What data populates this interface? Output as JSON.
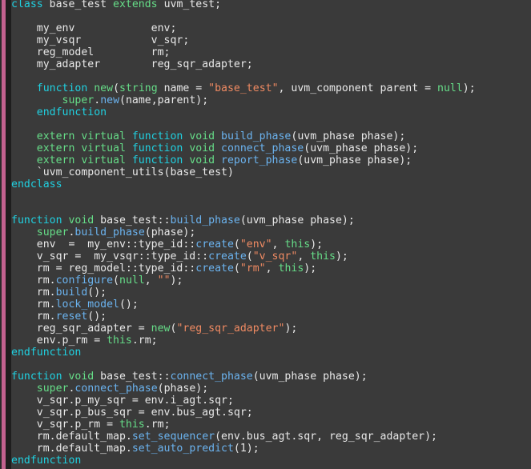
{
  "editor": {
    "language": "SystemVerilog",
    "colors": {
      "background": "#3a3a3a",
      "gutter": "#1e1e1e",
      "accent_stripe": "#c2628f",
      "default_text": "#e8e8e8",
      "keyword_cyan": "#20d0e0",
      "keyword_green": "#66dd88",
      "function_blue": "#6bb3ef",
      "string_orange": "#ef8a62"
    },
    "lines": [
      [
        {
          "t": "class ",
          "c": "kw"
        },
        {
          "t": "base_test ",
          "c": "plain"
        },
        {
          "t": "extends ",
          "c": "kw2"
        },
        {
          "t": "uvm_test;",
          "c": "plain"
        }
      ],
      [],
      [
        {
          "t": "    my_env            env;",
          "c": "plain"
        }
      ],
      [
        {
          "t": "    my_vsqr           v_sqr;",
          "c": "plain"
        }
      ],
      [
        {
          "t": "    reg_model         rm;",
          "c": "plain"
        }
      ],
      [
        {
          "t": "    my_adapter        reg_sqr_adapter;",
          "c": "plain"
        }
      ],
      [],
      [
        {
          "t": "    ",
          "c": "plain"
        },
        {
          "t": "function ",
          "c": "kw"
        },
        {
          "t": "new",
          "c": "kw2"
        },
        {
          "t": "(",
          "c": "plain"
        },
        {
          "t": "string ",
          "c": "kw2"
        },
        {
          "t": "name = ",
          "c": "plain"
        },
        {
          "t": "\"base_test\"",
          "c": "str"
        },
        {
          "t": ", uvm_component parent = ",
          "c": "plain"
        },
        {
          "t": "null",
          "c": "kw2"
        },
        {
          "t": ");",
          "c": "plain"
        }
      ],
      [
        {
          "t": "        ",
          "c": "plain"
        },
        {
          "t": "super",
          "c": "kw2"
        },
        {
          "t": ".",
          "c": "plain"
        },
        {
          "t": "new",
          "c": "fn"
        },
        {
          "t": "(name,parent);",
          "c": "plain"
        }
      ],
      [
        {
          "t": "    endfunction",
          "c": "kw"
        }
      ],
      [],
      [
        {
          "t": "    ",
          "c": "plain"
        },
        {
          "t": "extern virtual ",
          "c": "kw2"
        },
        {
          "t": "function ",
          "c": "kw"
        },
        {
          "t": "void ",
          "c": "kw2"
        },
        {
          "t": "build_phase",
          "c": "fn"
        },
        {
          "t": "(uvm_phase phase);",
          "c": "plain"
        }
      ],
      [
        {
          "t": "    ",
          "c": "plain"
        },
        {
          "t": "extern virtual ",
          "c": "kw2"
        },
        {
          "t": "function ",
          "c": "kw"
        },
        {
          "t": "void ",
          "c": "kw2"
        },
        {
          "t": "connect_phase",
          "c": "fn"
        },
        {
          "t": "(uvm_phase phase);",
          "c": "plain"
        }
      ],
      [
        {
          "t": "    ",
          "c": "plain"
        },
        {
          "t": "extern virtual ",
          "c": "kw2"
        },
        {
          "t": "function ",
          "c": "kw"
        },
        {
          "t": "void ",
          "c": "kw2"
        },
        {
          "t": "report_phase",
          "c": "fn"
        },
        {
          "t": "(uvm_phase phase);",
          "c": "plain"
        }
      ],
      [
        {
          "t": "    `uvm_component_utils(base_test)",
          "c": "plain"
        }
      ],
      [
        {
          "t": "endclass",
          "c": "kw"
        }
      ],
      [],
      [],
      [
        {
          "t": "function ",
          "c": "kw"
        },
        {
          "t": "void ",
          "c": "kw2"
        },
        {
          "t": "base_test::",
          "c": "plain"
        },
        {
          "t": "build_phase",
          "c": "fn"
        },
        {
          "t": "(uvm_phase phase);",
          "c": "plain"
        }
      ],
      [
        {
          "t": "    ",
          "c": "plain"
        },
        {
          "t": "super",
          "c": "kw2"
        },
        {
          "t": ".",
          "c": "plain"
        },
        {
          "t": "build_phase",
          "c": "fn"
        },
        {
          "t": "(phase);",
          "c": "plain"
        }
      ],
      [
        {
          "t": "    env  =  my_env::type_id::",
          "c": "plain"
        },
        {
          "t": "create",
          "c": "fn"
        },
        {
          "t": "(",
          "c": "plain"
        },
        {
          "t": "\"env\"",
          "c": "str"
        },
        {
          "t": ", ",
          "c": "plain"
        },
        {
          "t": "this",
          "c": "this"
        },
        {
          "t": ");",
          "c": "plain"
        }
      ],
      [
        {
          "t": "    v_sqr =  my_vsqr::type_id::",
          "c": "plain"
        },
        {
          "t": "create",
          "c": "fn"
        },
        {
          "t": "(",
          "c": "plain"
        },
        {
          "t": "\"v_sqr\"",
          "c": "str"
        },
        {
          "t": ", ",
          "c": "plain"
        },
        {
          "t": "this",
          "c": "this"
        },
        {
          "t": ");",
          "c": "plain"
        }
      ],
      [
        {
          "t": "    rm = reg_model::type_id::",
          "c": "plain"
        },
        {
          "t": "create",
          "c": "fn"
        },
        {
          "t": "(",
          "c": "plain"
        },
        {
          "t": "\"rm\"",
          "c": "str"
        },
        {
          "t": ", ",
          "c": "plain"
        },
        {
          "t": "this",
          "c": "this"
        },
        {
          "t": ");",
          "c": "plain"
        }
      ],
      [
        {
          "t": "    rm.",
          "c": "plain"
        },
        {
          "t": "configure",
          "c": "fn"
        },
        {
          "t": "(",
          "c": "plain"
        },
        {
          "t": "null",
          "c": "kw2"
        },
        {
          "t": ", ",
          "c": "plain"
        },
        {
          "t": "\"\"",
          "c": "str"
        },
        {
          "t": ");",
          "c": "plain"
        }
      ],
      [
        {
          "t": "    rm.",
          "c": "plain"
        },
        {
          "t": "build",
          "c": "fn"
        },
        {
          "t": "();",
          "c": "plain"
        }
      ],
      [
        {
          "t": "    rm.",
          "c": "plain"
        },
        {
          "t": "lock_model",
          "c": "fn"
        },
        {
          "t": "();",
          "c": "plain"
        }
      ],
      [
        {
          "t": "    rm.",
          "c": "plain"
        },
        {
          "t": "reset",
          "c": "fn"
        },
        {
          "t": "();",
          "c": "plain"
        }
      ],
      [
        {
          "t": "    reg_sqr_adapter = ",
          "c": "plain"
        },
        {
          "t": "new",
          "c": "kw2"
        },
        {
          "t": "(",
          "c": "plain"
        },
        {
          "t": "\"reg_sqr_adapter\"",
          "c": "str"
        },
        {
          "t": ");",
          "c": "plain"
        }
      ],
      [
        {
          "t": "    env.p_rm = ",
          "c": "plain"
        },
        {
          "t": "this",
          "c": "this"
        },
        {
          "t": ".rm;",
          "c": "plain"
        }
      ],
      [
        {
          "t": "endfunction",
          "c": "kw"
        }
      ],
      [],
      [
        {
          "t": "function ",
          "c": "kw"
        },
        {
          "t": "void ",
          "c": "kw2"
        },
        {
          "t": "base_test::",
          "c": "plain"
        },
        {
          "t": "connect_phase",
          "c": "fn"
        },
        {
          "t": "(uvm_phase phase);",
          "c": "plain"
        }
      ],
      [
        {
          "t": "    ",
          "c": "plain"
        },
        {
          "t": "super",
          "c": "kw2"
        },
        {
          "t": ".",
          "c": "plain"
        },
        {
          "t": "connect_phase",
          "c": "fn"
        },
        {
          "t": "(phase);",
          "c": "plain"
        }
      ],
      [
        {
          "t": "    v_sqr.p_my_sqr = env.i_agt.sqr;",
          "c": "plain"
        }
      ],
      [
        {
          "t": "    v_sqr.p_bus_sqr = env.bus_agt.sqr;",
          "c": "plain"
        }
      ],
      [
        {
          "t": "    v_sqr.p_rm = ",
          "c": "plain"
        },
        {
          "t": "this",
          "c": "this"
        },
        {
          "t": ".rm;",
          "c": "plain"
        }
      ],
      [
        {
          "t": "    rm.default_map.",
          "c": "plain"
        },
        {
          "t": "set_sequencer",
          "c": "fn"
        },
        {
          "t": "(env.bus_agt.sqr, reg_sqr_adapter);",
          "c": "plain"
        }
      ],
      [
        {
          "t": "    rm.default_map.",
          "c": "plain"
        },
        {
          "t": "set_auto_predict",
          "c": "fn"
        },
        {
          "t": "(1);",
          "c": "plain"
        }
      ],
      [
        {
          "t": "endfunction",
          "c": "kw"
        }
      ]
    ]
  }
}
